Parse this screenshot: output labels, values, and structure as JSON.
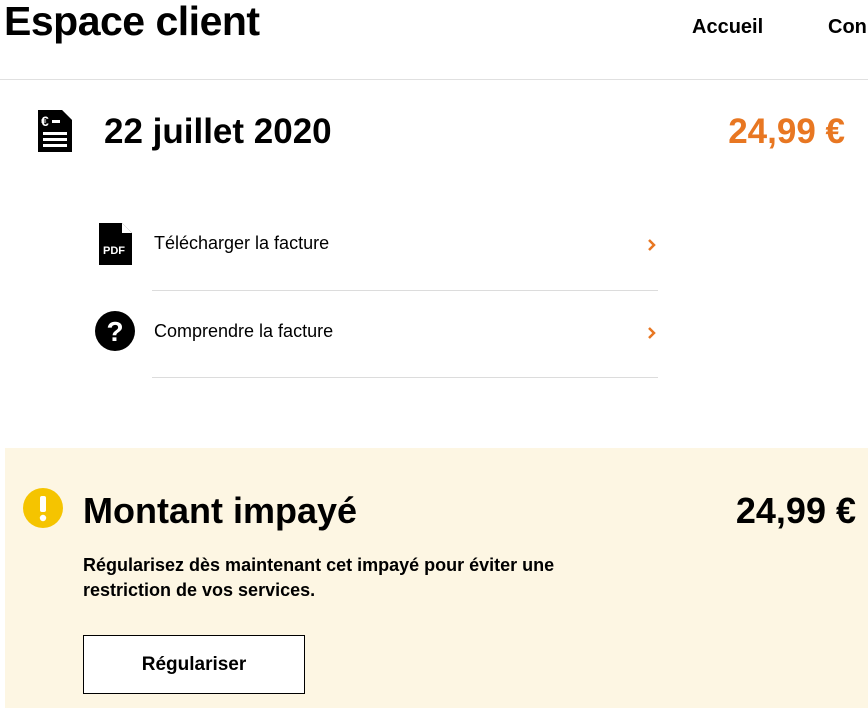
{
  "header": {
    "title": "Espace client",
    "nav": [
      "Accueil",
      "Con"
    ]
  },
  "invoice": {
    "icon": "invoice-euro-icon",
    "date": "22 juillet 2020",
    "amount": "24,99 €",
    "amount_color": "#e87722"
  },
  "actions": [
    {
      "icon": "pdf-icon",
      "label": "Télécharger la facture",
      "chevron": "chevron-right-icon"
    },
    {
      "icon": "question-icon",
      "label": "Comprendre la facture",
      "chevron": "chevron-right-icon"
    }
  ],
  "alert": {
    "icon": "warning-icon",
    "icon_color": "#f5c400",
    "background": "#fdf6e3",
    "title": "Montant impayé",
    "amount": "24,99 €",
    "text": "Régularisez dès maintenant cet impayé pour éviter une restriction de vos services.",
    "button_label": "Régulariser"
  }
}
